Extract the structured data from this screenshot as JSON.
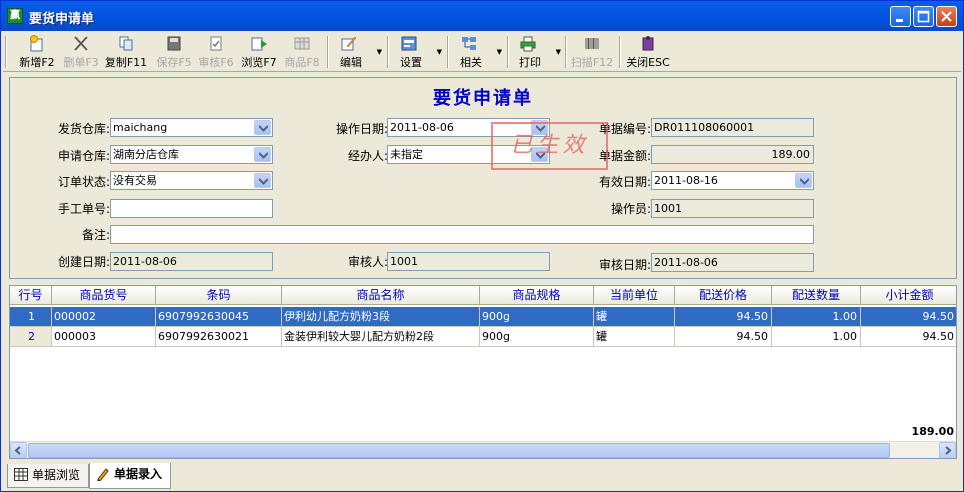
{
  "window": {
    "title": "要货申请单",
    "app_icon_text": "赢"
  },
  "toolbar": [
    {
      "label": "新增F2",
      "icon": "new-document-icon",
      "enabled": true
    },
    {
      "label": "删单F3",
      "icon": "delete-icon",
      "enabled": false
    },
    {
      "label": "复制F11",
      "icon": "copy-icon",
      "enabled": true
    },
    {
      "label": "保存F5",
      "icon": "save-icon",
      "enabled": false
    },
    {
      "label": "审核F6",
      "icon": "audit-icon",
      "enabled": false
    },
    {
      "label": "浏览F7",
      "icon": "browse-icon",
      "enabled": true
    },
    {
      "label": "商品F8",
      "icon": "goods-icon",
      "enabled": false
    },
    {
      "label": "编辑",
      "icon": "edit-icon",
      "enabled": true,
      "dropdown": true
    },
    {
      "label": "设置",
      "icon": "settings-icon",
      "enabled": true,
      "dropdown": true
    },
    {
      "label": "相关",
      "icon": "related-icon",
      "enabled": true,
      "dropdown": true
    },
    {
      "label": "打印",
      "icon": "printer-icon",
      "enabled": true,
      "dropdown": true
    },
    {
      "label": "扫描F12",
      "icon": "barcode-icon",
      "enabled": false
    },
    {
      "label": "关闭ESC",
      "icon": "exit-icon",
      "enabled": true
    }
  ],
  "form": {
    "title": "要货申请单",
    "labels": {
      "ship_warehouse": "发货仓库:",
      "request_warehouse": "申请仓库:",
      "order_status": "订单状态:",
      "manual_no": "手工单号:",
      "remark": "备注:",
      "created_date": "创建日期:",
      "op_date": "操作日期:",
      "handler": "经办人:",
      "reviewer": "审核人:",
      "doc_no": "单据编号:",
      "doc_amount": "单据金额:",
      "valid_date": "有效日期:",
      "operator": "操作员:",
      "review_date": "审核日期:"
    },
    "values": {
      "ship_warehouse": "maichang",
      "request_warehouse": "湖南分店仓库",
      "order_status": "没有交易",
      "manual_no": "",
      "remark": "",
      "created_date": "2011-08-06",
      "op_date": "2011-08-06",
      "handler": "未指定",
      "reviewer": "1001",
      "doc_no": "DR011108060001",
      "doc_amount": "189.00",
      "valid_date": "2011-08-16",
      "operator": "1001",
      "review_date": "2011-08-06"
    },
    "stamp": "已生效"
  },
  "grid": {
    "columns": [
      "行号",
      "商品货号",
      "条码",
      "商品名称",
      "商品规格",
      "当前单位",
      "配送价格",
      "配送数量",
      "小计金额"
    ],
    "rows": [
      {
        "no": "1",
        "code": "000002",
        "barcode": "6907992630045",
        "name": "伊利幼儿配方奶粉3段",
        "spec": "900g",
        "unit": "罐",
        "price": "94.50",
        "qty": "1.00",
        "subtotal": "94.50"
      },
      {
        "no": "2",
        "code": "000003",
        "barcode": "6907992630021",
        "name": "金装伊利较大婴儿配方奶粉2段",
        "spec": "900g",
        "unit": "罐",
        "price": "94.50",
        "qty": "1.00",
        "subtotal": "94.50"
      }
    ],
    "total": "189.00"
  },
  "tabs": [
    {
      "label": "单据浏览",
      "icon": "table-icon",
      "active": false
    },
    {
      "label": "单据录入",
      "icon": "pen-icon",
      "active": true
    }
  ]
}
